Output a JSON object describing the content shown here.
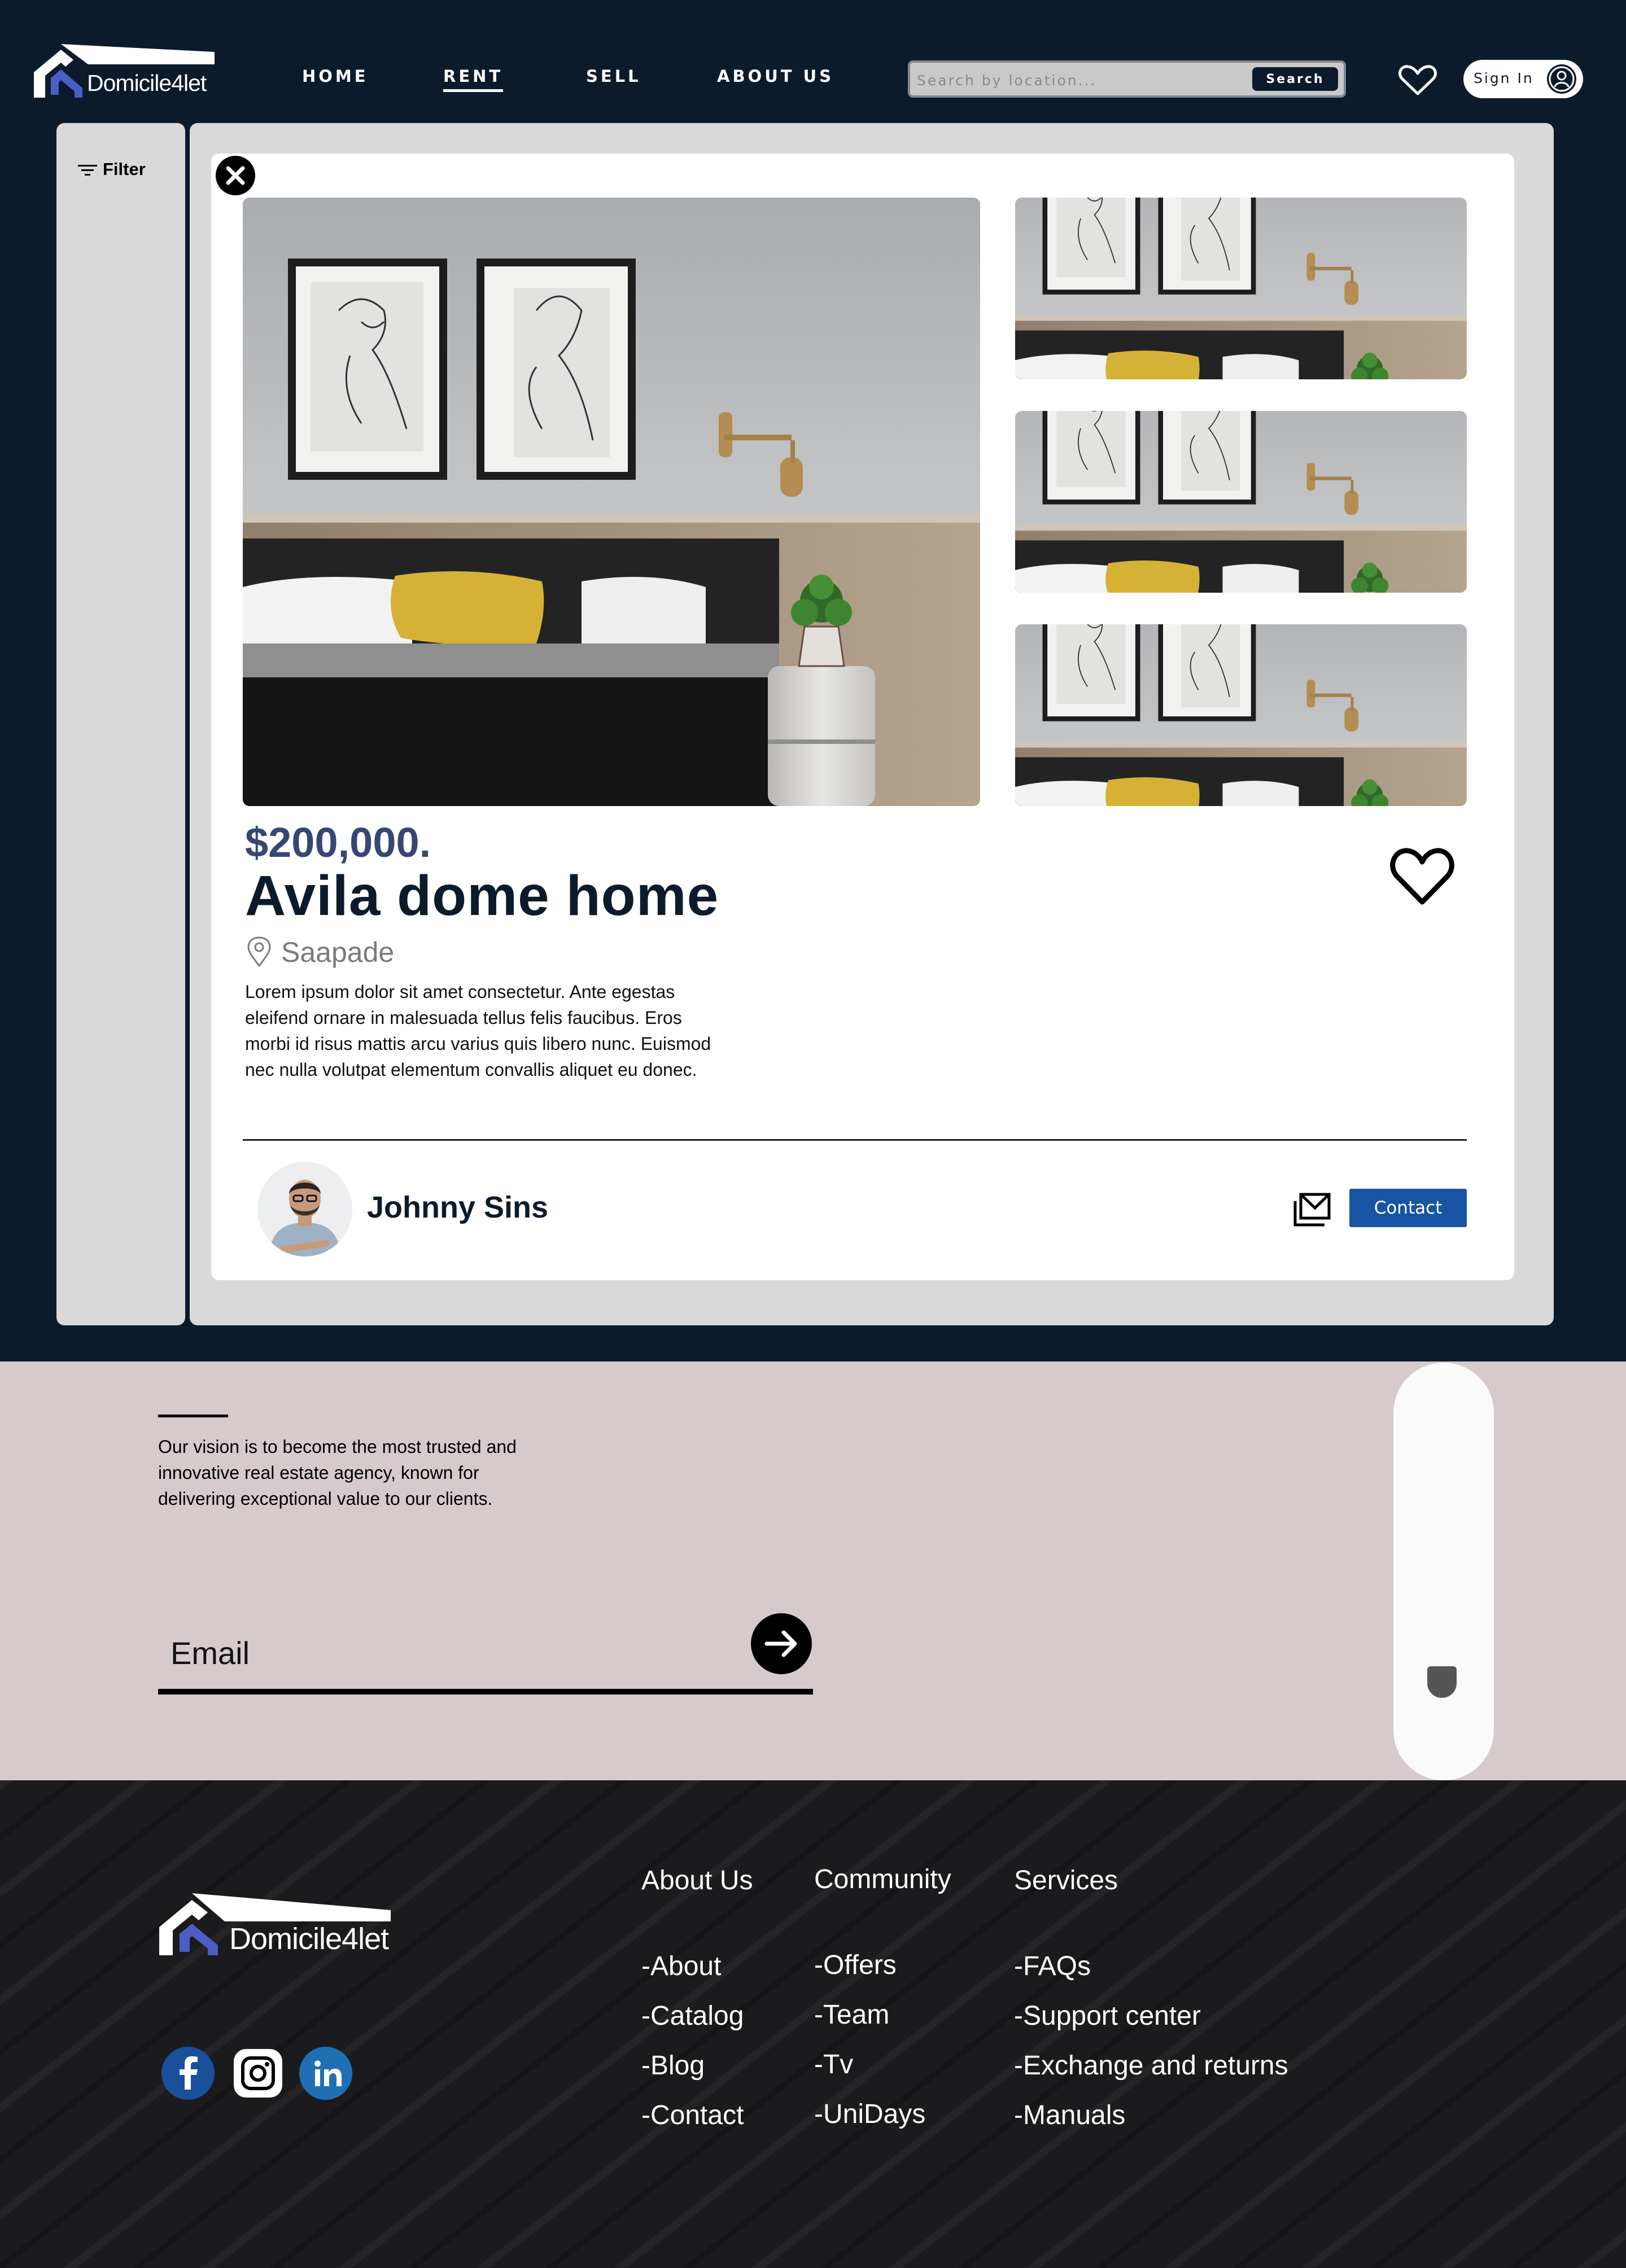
{
  "header": {
    "logo_text": "Domicile4let",
    "nav": [
      {
        "label": "HOME"
      },
      {
        "label": "RENT",
        "active": true
      },
      {
        "label": "SELL"
      },
      {
        "label": "ABOUT US"
      }
    ],
    "search": {
      "placeholder": "Search by location...",
      "button_label": "Search"
    },
    "signin_label": "Sign In"
  },
  "sidebar": {
    "filter_label": "Filter"
  },
  "listing": {
    "price": "$200,000.",
    "title": "Avila dome home",
    "location": "Saapade",
    "description": "Lorem ipsum dolor sit amet consectetur. Ante egestas eleifend ornare in malesuada tellus felis faucibus. Eros morbi id risus mattis arcu varius quis libero nunc. Euismod nec nulla volutpat elementum convallis aliquet eu donec."
  },
  "agent": {
    "name": "Johnny Sins",
    "contact_label": "Contact"
  },
  "newsletter": {
    "vision": "Our vision is to become the most trusted and innovative real estate agency, known for delivering exceptional value to our clients.",
    "email_placeholder": "Email"
  },
  "footer": {
    "logo_text": "Domicile4let",
    "social": [
      "facebook-icon",
      "instagram-icon",
      "linkedin-icon"
    ],
    "columns": [
      {
        "title": "About Us",
        "links": [
          "-About",
          "-Catalog",
          "-Blog",
          "-Contact"
        ]
      },
      {
        "title": "Community",
        "links": [
          "-Offers",
          "-Team",
          "-Tv",
          "-UniDays"
        ]
      },
      {
        "title": "Services",
        "links": [
          "-FAQs",
          "-Support center",
          "-Exchange and returns",
          "-Manuals"
        ]
      }
    ]
  },
  "colors": {
    "navy": "#0c1b2c",
    "panel_gray": "#d9d9d9",
    "price_blue": "#364772",
    "contact_blue": "#1755a4",
    "newsletter_bg": "#d5cbcc",
    "footer_bg": "#1c1c1e",
    "logo_accent": "#4a5ec4"
  }
}
